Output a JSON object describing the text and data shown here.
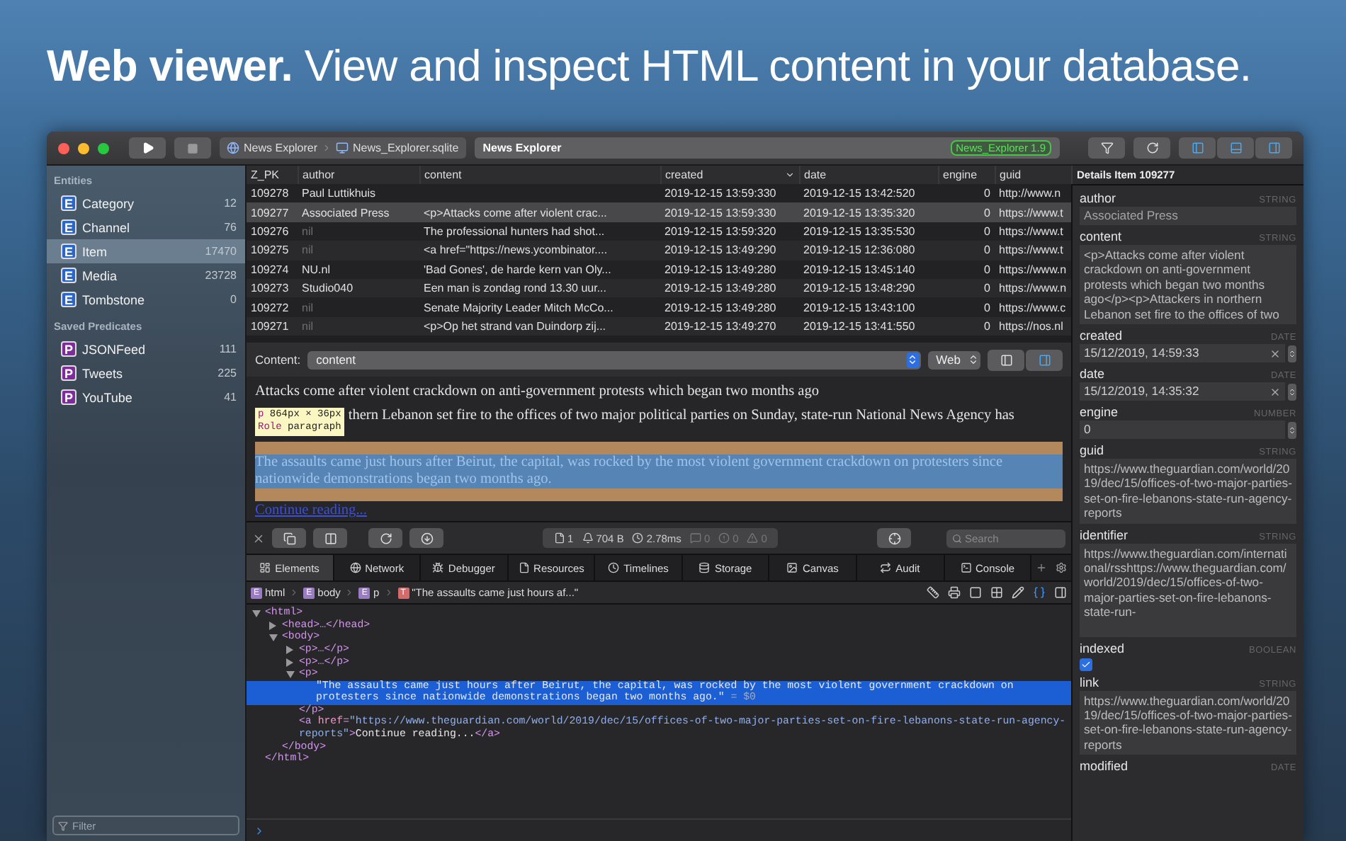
{
  "headline": "**Web viewer.** View and inspect HTML content in your database.",
  "toolbar": {
    "path": [
      "News Explorer",
      "News_Explorer.sqlite"
    ],
    "address": "News Explorer",
    "badge": "News_Explorer 1.9"
  },
  "sidebar": {
    "sections": [
      {
        "title": "Entities",
        "items": [
          {
            "badge": "E",
            "color": "#2a66c8",
            "label": "Category",
            "count": "12",
            "selected": false
          },
          {
            "badge": "E",
            "color": "#2a66c8",
            "label": "Channel",
            "count": "76",
            "selected": false
          },
          {
            "badge": "E",
            "color": "#2a66c8",
            "label": "Item",
            "count": "17470",
            "selected": true
          },
          {
            "badge": "E",
            "color": "#2a66c8",
            "label": "Media",
            "count": "23728",
            "selected": false
          },
          {
            "badge": "E",
            "color": "#2a66c8",
            "label": "Tombstone",
            "count": "0",
            "selected": false
          }
        ]
      },
      {
        "title": "Saved Predicates",
        "items": [
          {
            "badge": "P",
            "color": "#7e2c9c",
            "label": "JSONFeed",
            "count": "111",
            "selected": false
          },
          {
            "badge": "P",
            "color": "#7e2c9c",
            "label": "Tweets",
            "count": "225",
            "selected": false
          },
          {
            "badge": "P",
            "color": "#7e2c9c",
            "label": "YouTube",
            "count": "41",
            "selected": false
          }
        ]
      }
    ],
    "filter": {
      "placeholder": "Filter"
    }
  },
  "table": {
    "columns": [
      {
        "label": "Z_PK",
        "sorted": false
      },
      {
        "label": "author",
        "sorted": false
      },
      {
        "label": "content",
        "sorted": false
      },
      {
        "label": "created",
        "sorted": true
      },
      {
        "label": "date",
        "sorted": false
      },
      {
        "label": "engine",
        "sorted": false
      },
      {
        "label": "guid",
        "sorted": false
      }
    ],
    "rows": [
      {
        "selected": false,
        "author_nil": false,
        "cells": [
          "109278",
          "Paul Luttikhuis",
          null,
          "2019-12-15 13:59:330",
          "2019-12-15 13:42:520",
          "0",
          "http://www.n"
        ]
      },
      {
        "selected": true,
        "author_nil": false,
        "cells": [
          "109277",
          "Associated Press",
          "<p>Attacks come after violent crac...",
          "2019-12-15 13:59:330",
          "2019-12-15 13:35:320",
          "0",
          "https://www.t"
        ]
      },
      {
        "selected": false,
        "author_nil": true,
        "cells": [
          "109276",
          "nil",
          "The professional hunters had shot...",
          "2019-12-15 13:59:320",
          "2019-12-15 13:35:530",
          "0",
          "https://www.t"
        ]
      },
      {
        "selected": false,
        "author_nil": true,
        "cells": [
          "109275",
          "nil",
          "<a href=\"https://news.ycombinator....",
          "2019-12-15 13:49:290",
          "2019-12-15 12:36:080",
          "0",
          "https://www.t"
        ]
      },
      {
        "selected": false,
        "author_nil": false,
        "cells": [
          "109274",
          "NU.nl",
          "'Bad Gones', de harde kern van Oly...",
          "2019-12-15 13:49:280",
          "2019-12-15 13:45:140",
          "0",
          "https://www.n"
        ]
      },
      {
        "selected": false,
        "author_nil": false,
        "cells": [
          "109273",
          "Studio040",
          "Een man is zondag rond 13.30 uur...",
          "2019-12-15 13:49:280",
          "2019-12-15 13:48:290",
          "0",
          "https://www.n"
        ]
      },
      {
        "selected": false,
        "author_nil": true,
        "cells": [
          "109272",
          "nil",
          "Senate Majority Leader Mitch McCo...",
          "2019-12-15 13:49:280",
          "2019-12-15 13:43:100",
          "0",
          "https://www.c"
        ]
      },
      {
        "selected": false,
        "author_nil": true,
        "cells": [
          "109271",
          "nil",
          "<p>Op het strand van Duindorp zij...",
          "2019-12-15 13:49:270",
          "2019-12-15 13:41:550",
          "0",
          "https://nos.nl"
        ]
      }
    ]
  },
  "content_bar": {
    "label": "Content:",
    "field": "content",
    "mode": "Web"
  },
  "web_view": {
    "first": "Attacks come after violent crackdown on anti-government protests which began two months ago",
    "tooltip": {
      "tag": "p",
      "size": "864px × 36px",
      "role_label": "Role",
      "role": "paragraph"
    },
    "second": "thern Lebanon set fire to the offices of two major political parties on Sunday, state-run National News Agency has",
    "highlighted": "The assaults came just hours after Beirut, the capital, was rocked by the most violent government crackdown on protesters since nationwide demonstrations began two months ago.",
    "link": "Continue reading..."
  },
  "devtools": {
    "stats": [
      "1",
      "704 B",
      "2.78ms",
      "0",
      "0",
      "0"
    ],
    "search": {
      "placeholder": "Search"
    },
    "tabs": [
      {
        "label": "Elements",
        "selected": true
      },
      {
        "label": "Network",
        "selected": false
      },
      {
        "label": "Debugger",
        "selected": false
      },
      {
        "label": "Resources",
        "selected": false
      },
      {
        "label": "Timelines",
        "selected": false
      },
      {
        "label": "Storage",
        "selected": false
      },
      {
        "label": "Canvas",
        "selected": false
      },
      {
        "label": "Audit",
        "selected": false
      },
      {
        "label": "Console",
        "selected": false
      }
    ],
    "breadcrumb": [
      {
        "badge": "E",
        "color": "#9a7cc0",
        "label": "html"
      },
      {
        "badge": "E",
        "color": "#9a7cc0",
        "label": "body"
      },
      {
        "badge": "E",
        "color": "#9a7cc0",
        "label": "p"
      },
      {
        "badge": "T",
        "color": "#d46a6a",
        "label": "\"The assaults came just hours af...\""
      }
    ],
    "tree": [
      {
        "expanded": true,
        "selected": false,
        "segments": [
          {
            "kind": "tag",
            "text": "<html>"
          }
        ],
        "close": "</html>",
        "children": [
          {
            "expanded": false,
            "selected": false,
            "segments": [
              {
                "kind": "tag",
                "text": "<head>…</head>"
              }
            ]
          },
          {
            "expanded": true,
            "selected": false,
            "segments": [
              {
                "kind": "tag",
                "text": "<body>"
              }
            ],
            "close": "</body>",
            "children": [
              {
                "expanded": false,
                "selected": false,
                "segments": [
                  {
                    "kind": "tag",
                    "text": "<p>…</p>"
                  }
                ]
              },
              {
                "expanded": false,
                "selected": false,
                "segments": [
                  {
                    "kind": "tag",
                    "text": "<p>…</p>"
                  }
                ]
              },
              {
                "expanded": true,
                "selected": false,
                "segments": [
                  {
                    "kind": "tag",
                    "text": "<p>"
                  }
                ],
                "close": "</p>",
                "children": [
                  {
                    "selected": true,
                    "segments": [
                      {
                        "kind": "text",
                        "text": "\"The assaults came just hours after Beirut, the capital, was rocked by the most violent government crackdown on protesters since nationwide demonstrations began two months ago.\""
                      },
                      {
                        "kind": "note",
                        "text": " = $0"
                      }
                    ]
                  }
                ]
              },
              {
                "selected": false,
                "segments": [
                  {
                    "kind": "tag",
                    "text": "<a "
                  },
                  {
                    "kind": "attr",
                    "text": "href"
                  },
                  {
                    "kind": "tag",
                    "text": "="
                  },
                  {
                    "kind": "value",
                    "text": "\"https://www.theguardian.com/world/2019/dec/15/offices-of-two-major-parties-set-on-fire-lebanons-state-run-agency-reports\""
                  },
                  {
                    "kind": "tag",
                    "text": ">"
                  },
                  {
                    "kind": "text",
                    "text": "Continue reading..."
                  },
                  {
                    "kind": "tag",
                    "text": "</a>"
                  }
                ]
              }
            ]
          }
        ]
      }
    ]
  },
  "details": {
    "title": "Details Item",
    "id": "109277",
    "fields": [
      {
        "kind": "line",
        "name": "author",
        "type": "STRING",
        "value": "Associated Press"
      },
      {
        "kind": "area",
        "name": "content",
        "type": "STRING",
        "value": "<p>Attacks come after violent crackdown on anti-government protests which began two months ago</p><p>Attackers in northern Lebanon set fire to the offices of two"
      },
      {
        "kind": "date",
        "name": "created",
        "type": "DATE",
        "value": "15/12/2019, 14:59:33"
      },
      {
        "kind": "date",
        "name": "date",
        "type": "DATE",
        "value": "15/12/2019, 14:35:32"
      },
      {
        "kind": "number",
        "name": "engine",
        "type": "NUMBER",
        "value": "0"
      },
      {
        "kind": "area",
        "name": "guid",
        "type": "STRING",
        "value": "https://www.theguardian.com/world/2019/dec/15/offices-of-two-major-parties-set-on-fire-lebanons-state-run-agency-reports"
      },
      {
        "kind": "area",
        "name": "identifier",
        "type": "STRING",
        "value": "https://www.theguardian.com/international/rsshttps://www.theguardian.com/world/2019/dec/15/offices-of-two-major-parties-set-on-fire-lebanons-state-run-"
      },
      {
        "kind": "boolean",
        "name": "indexed",
        "type": "BOOLEAN",
        "checked": true
      },
      {
        "kind": "area",
        "name": "link",
        "type": "STRING",
        "value": "https://www.theguardian.com/world/2019/dec/15/offices-of-two-major-parties-set-on-fire-lebanons-state-run-agency-reports"
      },
      {
        "kind": "header",
        "name": "modified",
        "type": "DATE"
      }
    ]
  }
}
